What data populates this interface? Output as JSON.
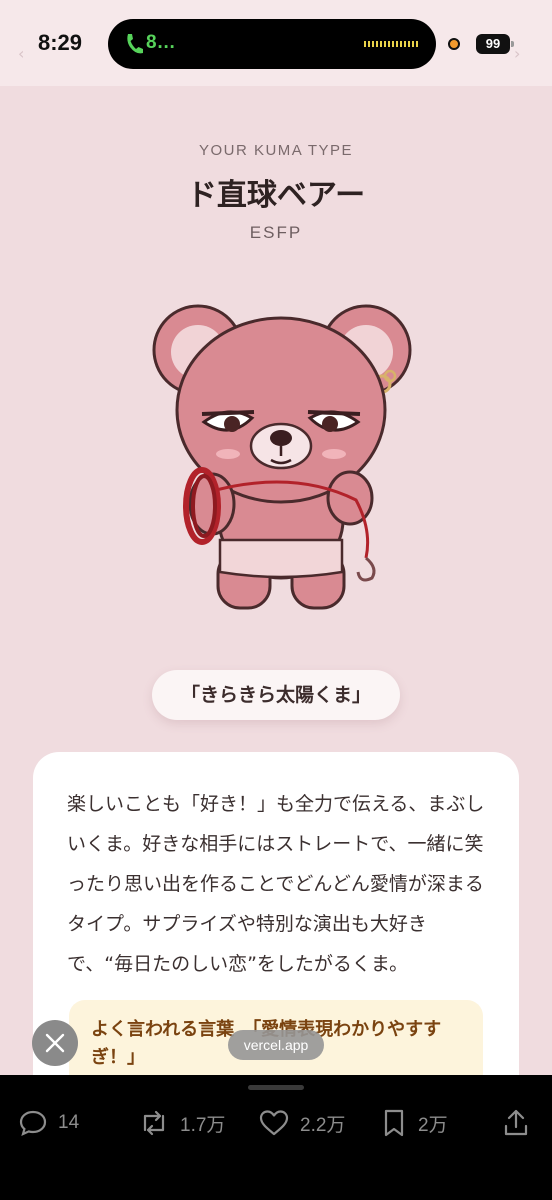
{
  "status_bar": {
    "time": "8:29",
    "call_label": "8…",
    "battery": "99"
  },
  "result": {
    "kicker": "YOUR KUMA TYPE",
    "title": "ド直球ベアー",
    "mbti": "ESFP",
    "nickname": "「きらきら太陽くま」",
    "description": "楽しいことも「好き！」も全力で伝える、まぶしいくま。好きな相手にはストレートで、一緒に笑ったり思い出を作ることでどんどん愛情が深まるタイプ。サプライズや特別な演出も大好きで、“毎日たのしい恋”をしたがるくま。",
    "quote": "よく言われる言葉　「愛情表現わかりやすすぎ！」"
  },
  "browser": {
    "url": "vercel.app"
  },
  "actions": {
    "replies": "14",
    "reposts": "1.7万",
    "likes": "2.2万",
    "bookmarks": "2万"
  },
  "colors": {
    "background": "#f0dcdf",
    "bear": "#d98a92",
    "quote_bg": "#fdf4dc",
    "quote_text": "#7a4310"
  }
}
